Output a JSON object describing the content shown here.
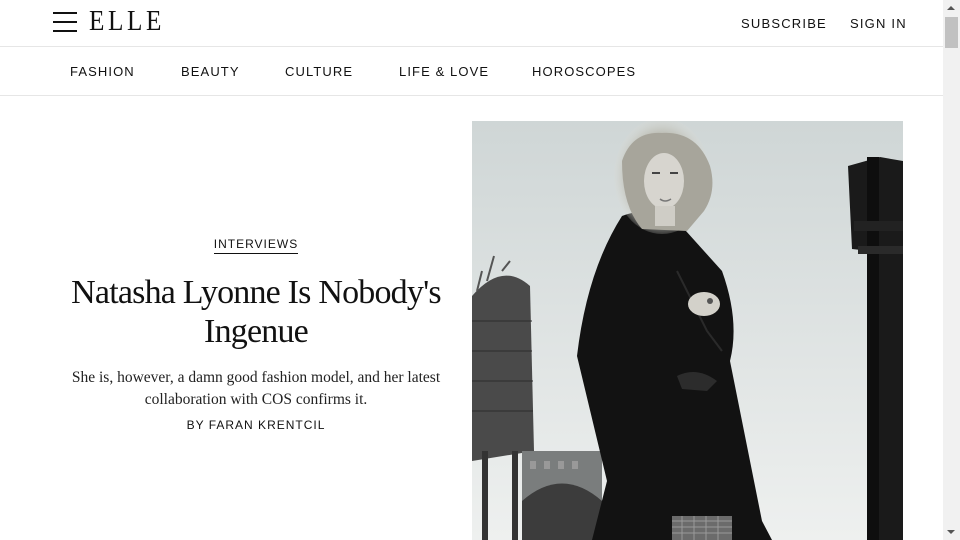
{
  "header": {
    "logo": "ELLE",
    "subscribe_label": "SUBSCRIBE",
    "sign_in_label": "SIGN IN"
  },
  "nav": {
    "items": [
      {
        "label": "FASHION"
      },
      {
        "label": "BEAUTY"
      },
      {
        "label": "CULTURE"
      },
      {
        "label": "LIFE & LOVE"
      },
      {
        "label": "HOROSCOPES"
      }
    ]
  },
  "article": {
    "kicker": "INTERVIEWS",
    "headline": "Natasha Lyonne Is Nobody's Ingenue",
    "dek": "She is, however, a damn good fashion model, and her latest collaboration with COS confirms it.",
    "byline": "BY FARAN KRENTCIL",
    "image_subject": "black-and-white fashion portrait with water towers"
  },
  "scrollbar": {
    "position_fraction": 0.0
  }
}
